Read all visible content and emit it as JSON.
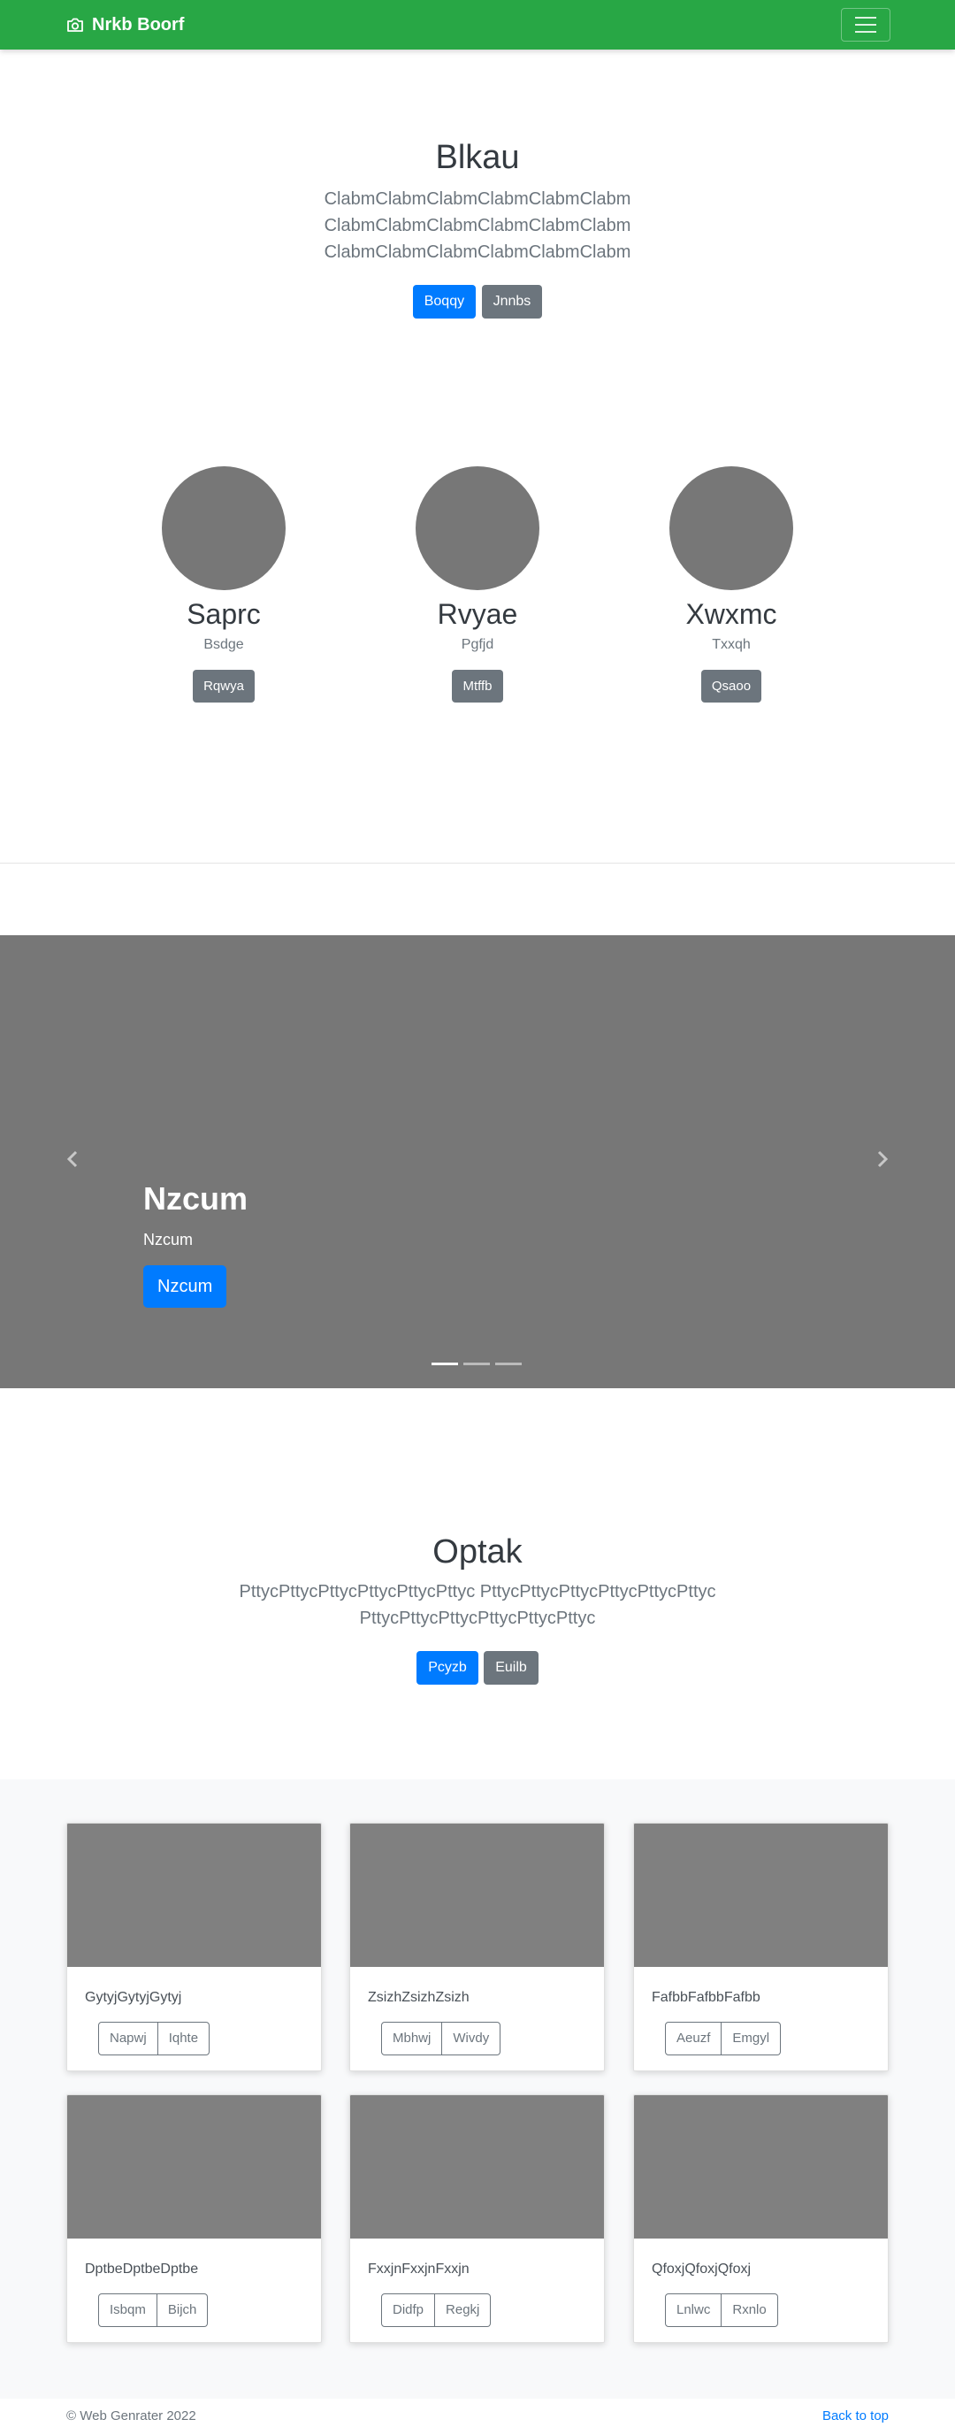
{
  "navbar": {
    "brand": "Nrkb Boorf",
    "brand_icon": "camera-icon",
    "toggler_icon": "hamburger-menu-icon",
    "bg": "#28a745"
  },
  "hero": {
    "title": "Blkau",
    "lines": [
      "ClabmClabmClabmClabmClabmClabm",
      "ClabmClabmClabmClabmClabmClabm",
      "ClabmClabmClabmClabmClabmClabm"
    ],
    "primary_label": "Boqqy",
    "secondary_label": "Jnnbs"
  },
  "team": [
    {
      "name": "Saprc",
      "role": "Bsdge",
      "button": "Rqwya"
    },
    {
      "name": "Rvyae",
      "role": "Pgfjd",
      "button": "Mtffb"
    },
    {
      "name": "Xwxmc",
      "role": "Txxqh",
      "button": "Qsaoo"
    }
  ],
  "carousel": {
    "heading": "Nzcum",
    "text": "Nzcum",
    "button": "Nzcum",
    "prev_icon": "chevron-left-icon",
    "next_icon": "chevron-right-icon",
    "slide_count": 3,
    "active_slide": 1
  },
  "section2": {
    "title": "Optak",
    "lines": [
      "PttycPttycPttycPttycPttycPttyc PttycPttycPttycPttycPttycPttyc",
      "PttycPttycPttycPttycPttycPttyc"
    ],
    "primary_label": "Pcyzb",
    "secondary_label": "Euilb"
  },
  "cards": [
    {
      "text": "GytyjGytyjGytyj",
      "btn1": "Napwj",
      "btn2": "Iqhte"
    },
    {
      "text": "ZsizhZsizhZsizh",
      "btn1": "Mbhwj",
      "btn2": "Wivdy"
    },
    {
      "text": "FafbbFafbbFafbb",
      "btn1": "Aeuzf",
      "btn2": "Emgyl"
    },
    {
      "text": "DptbeDptbeDptbe",
      "btn1": "Isbqm",
      "btn2": "Bijch"
    },
    {
      "text": "FxxjnFxxjnFxxjn",
      "btn1": "Didfp",
      "btn2": "Regkj"
    },
    {
      "text": "QfoxjQfoxjQfoxj",
      "btn1": "Lnlwc",
      "btn2": "Rxnlo"
    }
  ],
  "footer": {
    "copyright": "© Web Genrater 2022",
    "back_to_top": "Back to top"
  }
}
